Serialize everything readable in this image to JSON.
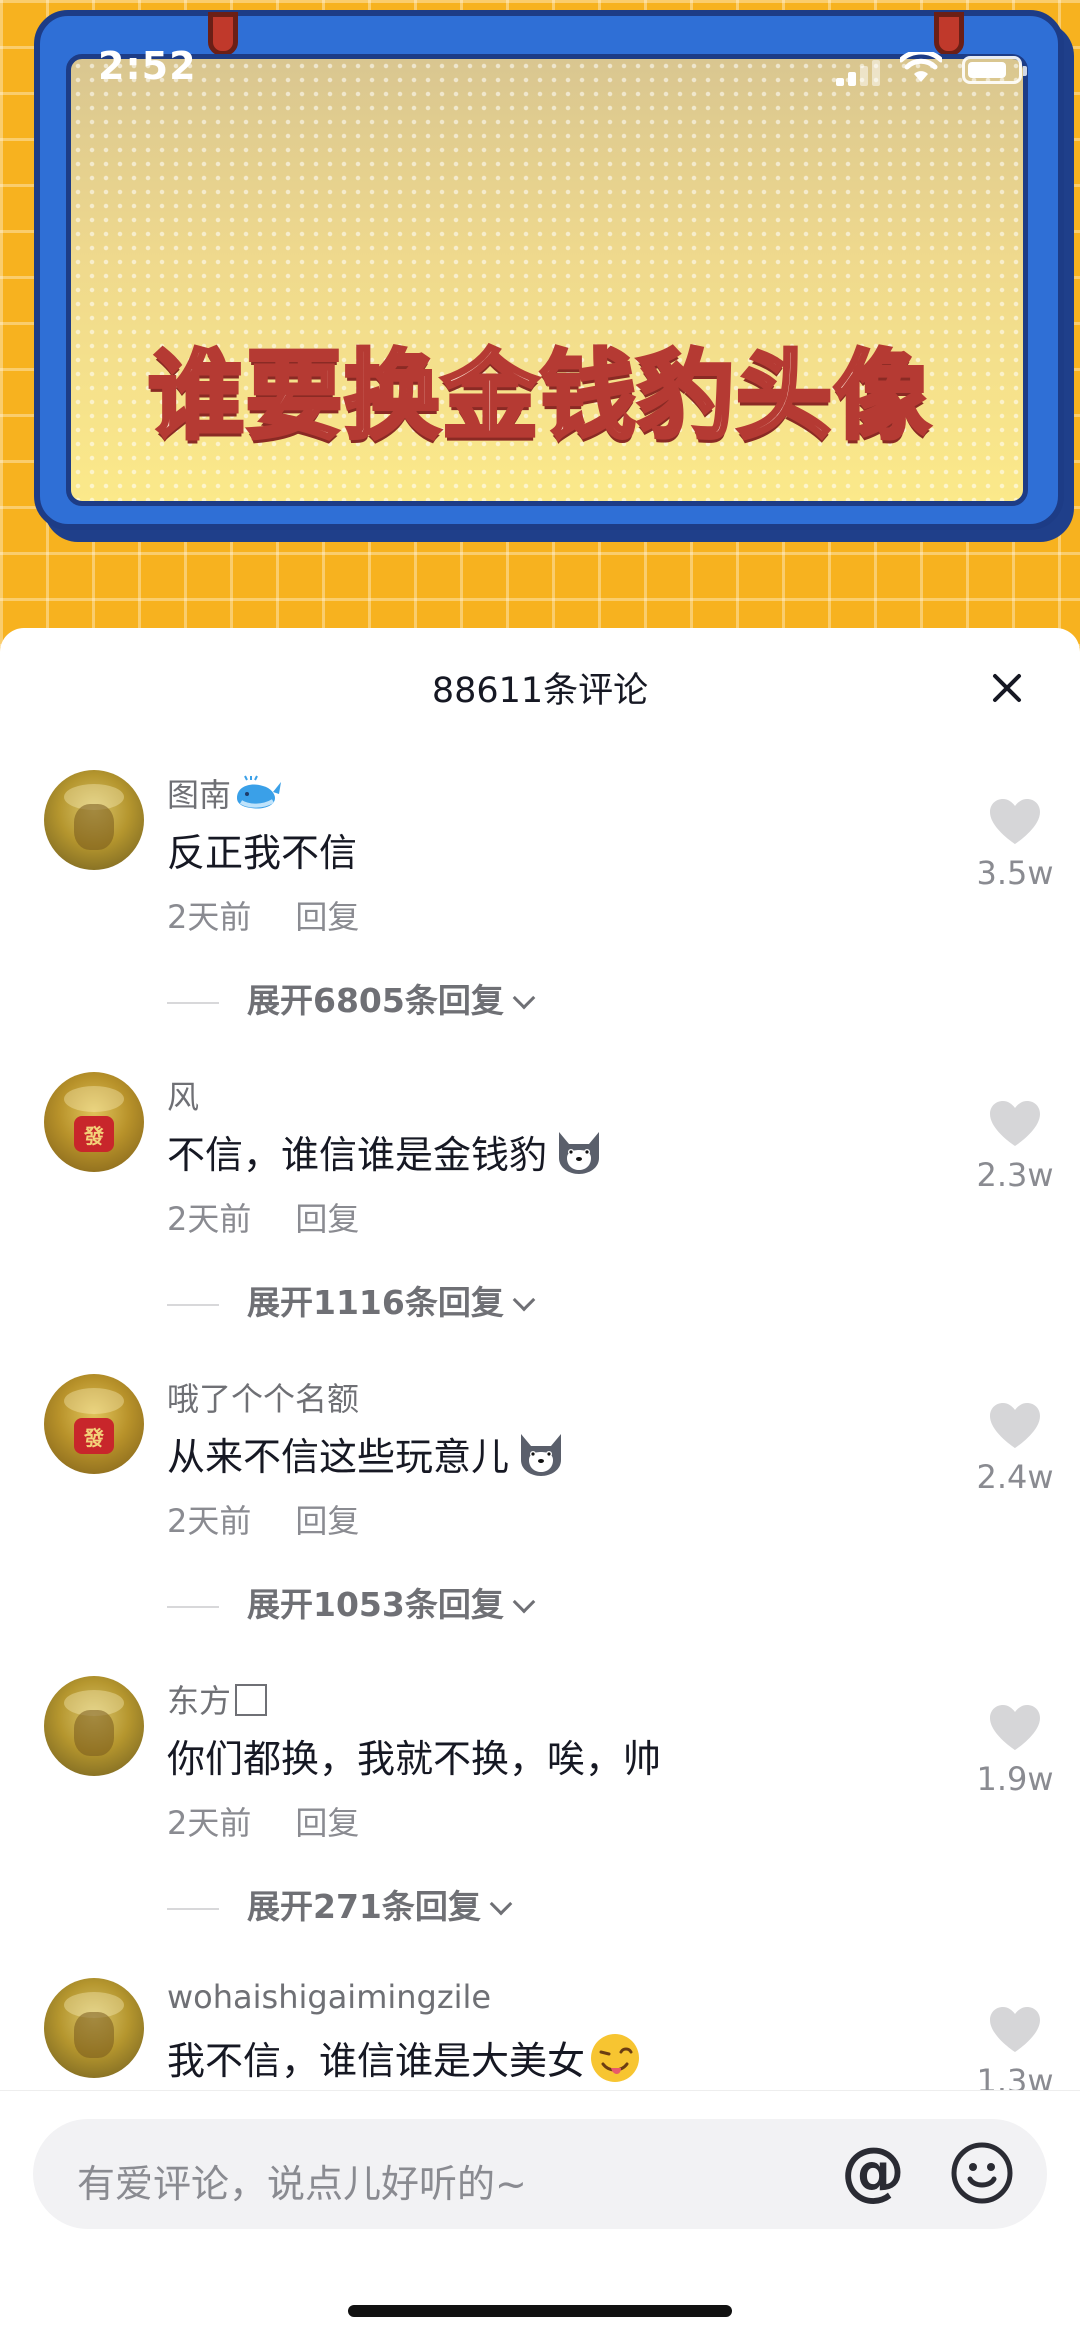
{
  "status_bar": {
    "time": "2:52"
  },
  "banner": {
    "title": "谁要换金钱豹头像"
  },
  "comments_panel": {
    "title": "88611条评论",
    "comments": [
      {
        "username": "图南",
        "text": "反正我不信",
        "time": "2天前",
        "reply_label": "回复",
        "expand_label": "展开6805条回复",
        "likes": "3.5w"
      },
      {
        "username": "风",
        "text": "不信，谁信谁是金钱豹",
        "time": "2天前",
        "reply_label": "回复",
        "expand_label": "展开1116条回复",
        "likes": "2.3w"
      },
      {
        "username": "哦了个个名额",
        "text": "从来不信这些玩意儿",
        "time": "2天前",
        "reply_label": "回复",
        "expand_label": "展开1053条回复",
        "likes": "2.4w"
      },
      {
        "username": "东方",
        "text": "你们都换，我就不换，唉，帅",
        "time": "2天前",
        "reply_label": "回复",
        "expand_label": "展开271条回复",
        "likes": "1.9w"
      },
      {
        "username": "wohaishigaimingzile",
        "text": "我不信，谁信谁是大美女",
        "likes": "1.3w"
      }
    ]
  },
  "input": {
    "placeholder": "有爱评论，说点儿好听的~",
    "at_symbol": "@"
  },
  "icons": {
    "close": "close-icon",
    "heart": "heart-icon",
    "emoji": "emoji-icon",
    "chevron": "chevron-down-icon"
  },
  "colors": {
    "banner_bg": "#f7b21f",
    "board_blue": "#2f6fd6",
    "title_red": "#b53a33",
    "text_primary": "#161823",
    "text_secondary": "#8a8b91"
  }
}
